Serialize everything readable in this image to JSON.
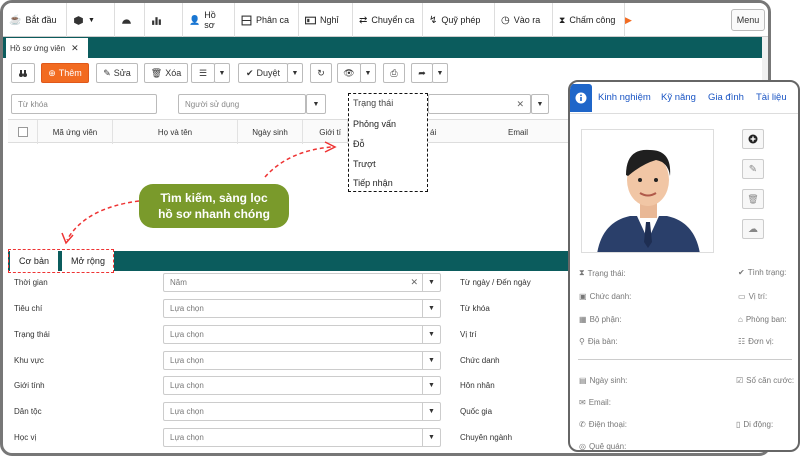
{
  "menu": {
    "items": [
      {
        "name": "start",
        "label": "Bắt đầu",
        "icon": "coffee-icon"
      },
      {
        "name": "cube",
        "label": "",
        "icon": "cube-icon"
      },
      {
        "name": "dashboard",
        "label": "",
        "icon": "dashboard-icon"
      },
      {
        "name": "chart",
        "label": "",
        "icon": "bar-chart-icon"
      },
      {
        "name": "profile",
        "label": "Hồ sơ",
        "icon": "user-icon"
      },
      {
        "name": "shift",
        "label": "Phân ca",
        "icon": "grid-icon"
      },
      {
        "name": "leave",
        "label": "Nghỉ",
        "icon": "id-card-icon"
      },
      {
        "name": "swap-shift",
        "label": "Chuyển ca",
        "icon": "swap-icon"
      },
      {
        "name": "leave-fund",
        "label": "Quỹ phép",
        "icon": "plug-icon"
      },
      {
        "name": "checkin",
        "label": "Vào ra",
        "icon": "clock-icon"
      },
      {
        "name": "timekeeping",
        "label": "Chấm công",
        "icon": "hourglass-icon"
      }
    ],
    "menu_button": "Menu"
  },
  "tabs": {
    "active": "Hồ sơ ứng viên"
  },
  "toolbar": {
    "add": "Thêm",
    "edit": "Sửa",
    "delete": "Xóa",
    "approve": "Duyệt"
  },
  "filters": {
    "keyword_placeholder": "Từ khóa",
    "user_placeholder": "Người sử dụng"
  },
  "table": {
    "headers": [
      "Mã ứng viên",
      "Họ và tên",
      "Ngày sinh",
      "Giới tí",
      "ái",
      "Email"
    ]
  },
  "status_dropdown": {
    "options": [
      "Trạng thái",
      "Phỏng vấn",
      "Đỗ",
      "Trượt",
      "Tiếp nhận"
    ]
  },
  "callout": {
    "line1": "Tìm kiếm, sàng lọc",
    "line2": "hồ sơ nhanh chóng"
  },
  "subtabs": {
    "basic": "Cơ bản",
    "extended": "Mở rộng"
  },
  "form": {
    "rows": [
      {
        "label": "Thời gian",
        "value": "Năm",
        "right": "Từ ngày / Đến ngày",
        "clear": true
      },
      {
        "label": "Tiêu chí",
        "value": "Lựa chọn",
        "right": "Từ khóa"
      },
      {
        "label": "Trạng thái",
        "value": "Lựa chọn",
        "right": "Vị trí"
      },
      {
        "label": "Khu vực",
        "value": "Lựa chọn",
        "right": "Chức danh"
      },
      {
        "label": "Giới tính",
        "value": "Lựa chọn",
        "right": "Hôn nhân"
      },
      {
        "label": "Dân tộc",
        "value": "Lựa chọn",
        "right": "Quốc gia"
      },
      {
        "label": "Học vị",
        "value": "Lựa chọn",
        "right": "Chuyên ngành"
      }
    ]
  },
  "side": {
    "tabs": [
      "Kinh nghiệm",
      "Kỹ năng",
      "Gia đình",
      "Tài liệu"
    ],
    "fields_left": [
      "Trạng thái:",
      "Chức danh:",
      "Bộ phận:",
      "Địa bàn:"
    ],
    "fields_right": [
      "Tình trạng:",
      "Vị trí:",
      "Phòng ban:",
      "Đơn vị:"
    ],
    "fields2_left": [
      "Ngày sinh:",
      "Email:",
      "Điện thoại:",
      "Quê quán:"
    ],
    "fields2_right": [
      "Số căn cước:",
      "Di động:"
    ]
  },
  "colors": {
    "teal": "#0b5c5d",
    "orange": "#f26b21",
    "callout": "#7a9a2b",
    "link": "#1a55c4"
  }
}
